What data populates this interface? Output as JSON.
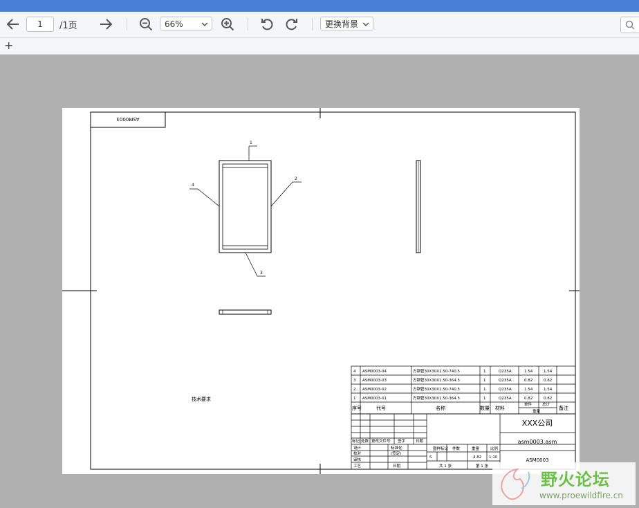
{
  "toolbar": {
    "page_current": "1",
    "page_total": "/1页",
    "zoom": "66%",
    "background_button": "更换背景"
  },
  "drawing": {
    "code_box_text": "ASM0003",
    "balloons": [
      "1",
      "2",
      "3",
      "4"
    ],
    "tech_requirements": "技术要求",
    "bom_rows": [
      {
        "no": "4",
        "code": "ASM0003-04",
        "name": "方钢管30X30X1.50-740.5",
        "qty": "1",
        "material": "Q235A",
        "unit_weight": "1.54",
        "total_weight": "1.54"
      },
      {
        "no": "3",
        "code": "ASM0003-03",
        "name": "方钢管30X30X1.50-364.5",
        "qty": "1",
        "material": "Q235A",
        "unit_weight": "0.82",
        "total_weight": "0.82"
      },
      {
        "no": "2",
        "code": "ASM0003-02",
        "name": "方钢管30X30X1.50-740.5",
        "qty": "1",
        "material": "Q235A",
        "unit_weight": "1.54",
        "total_weight": "1.54"
      },
      {
        "no": "1",
        "code": "ASM0003-01",
        "name": "方钢管30X30X1.50-364.5",
        "qty": "1",
        "material": "Q235A",
        "unit_weight": "0.82",
        "total_weight": "0.82"
      }
    ],
    "bom_header": {
      "no": "序号",
      "code": "代号",
      "name": "名称",
      "qty": "数量",
      "material": "材料",
      "unit": "单件",
      "total": "总计",
      "weight": "重量",
      "remark": "备注"
    },
    "title_block": {
      "company": "XXX公司",
      "filename": "asm0003.asm",
      "drawing_no": "ASM0003",
      "rev_labels": [
        "标记",
        "处数",
        "更改文件号",
        "签字",
        "日期"
      ],
      "roles": [
        "设计",
        "校对",
        "审核",
        "工艺"
      ],
      "std_label": "标准化",
      "std_sign": "(签定)",
      "date_label": "日期",
      "stage_label": "图样标记",
      "qty_label": "件数",
      "weight_label": "重量",
      "scale_label": "比例",
      "stage_value": "S",
      "weight_value": "4.82",
      "scale_value": "1:10",
      "sheets_total": "共 1 张",
      "sheet_no": "第 1 张"
    }
  },
  "watermark": {
    "text": "野火论坛",
    "url": "www.proewildfire.cn"
  }
}
